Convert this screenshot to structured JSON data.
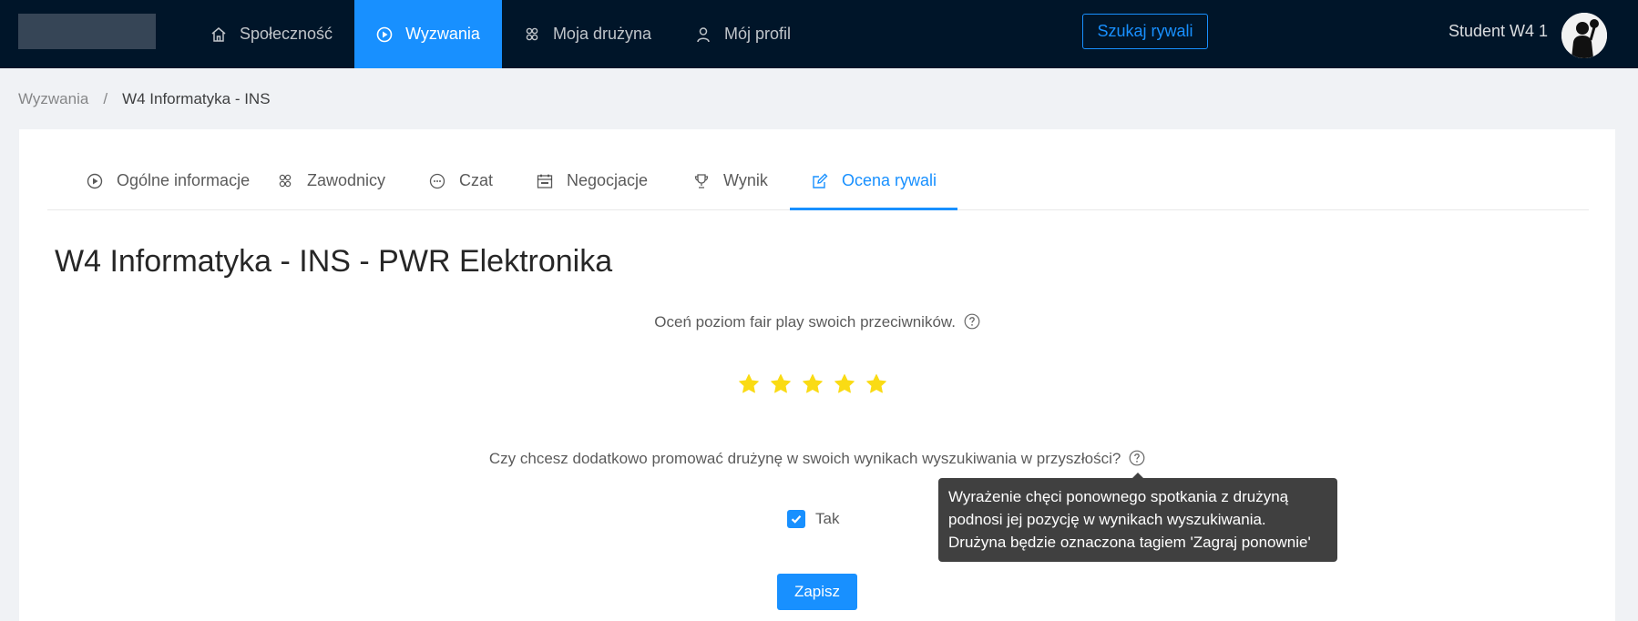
{
  "header": {
    "nav": [
      {
        "label": "Społeczność",
        "icon": "home-icon"
      },
      {
        "label": "Wyzwania",
        "icon": "play-circle-icon",
        "active": true
      },
      {
        "label": "Moja drużyna",
        "icon": "team-icon"
      },
      {
        "label": "Mój profil",
        "icon": "user-icon"
      }
    ],
    "search_button": "Szukaj rywali",
    "user_name": "Student W4 1"
  },
  "breadcrumb": {
    "items": [
      "Wyzwania",
      "W4 Informatyka - INS"
    ],
    "separator": "/"
  },
  "tabs": [
    {
      "label": "Ogólne informacje",
      "icon": "play-circle-icon"
    },
    {
      "label": "Zawodnicy",
      "icon": "team-icon"
    },
    {
      "label": "Czat",
      "icon": "message-icon"
    },
    {
      "label": "Negocjacje",
      "icon": "calendar-icon"
    },
    {
      "label": "Wynik",
      "icon": "trophy-icon"
    },
    {
      "label": "Ocena rywali",
      "icon": "edit-icon",
      "active": true
    }
  ],
  "main": {
    "title": "W4 Informatyka - INS - PWR Elektronika",
    "fair_play_question": "Oceń poziom fair play swoich przeciwników.",
    "rating": {
      "value": 5,
      "max": 5,
      "color": "#fadb14"
    },
    "promote_question": "Czy chcesz dodatkowo promować drużynę w swoich wynikach wyszukiwania w przyszłości?",
    "checkbox_label": "Tak",
    "checkbox_checked": true,
    "save_button": "Zapisz"
  },
  "tooltip": {
    "lines": [
      "Wyrażenie chęci ponownego spotkania z drużyną",
      "podnosi jej pozycję w wynikach wyszukiwania.",
      "Drużyna będzie oznaczona tagiem 'Zagraj ponownie'"
    ]
  },
  "colors": {
    "primary": "#1890ff",
    "header_bg": "#001529",
    "star": "#fadb14"
  }
}
